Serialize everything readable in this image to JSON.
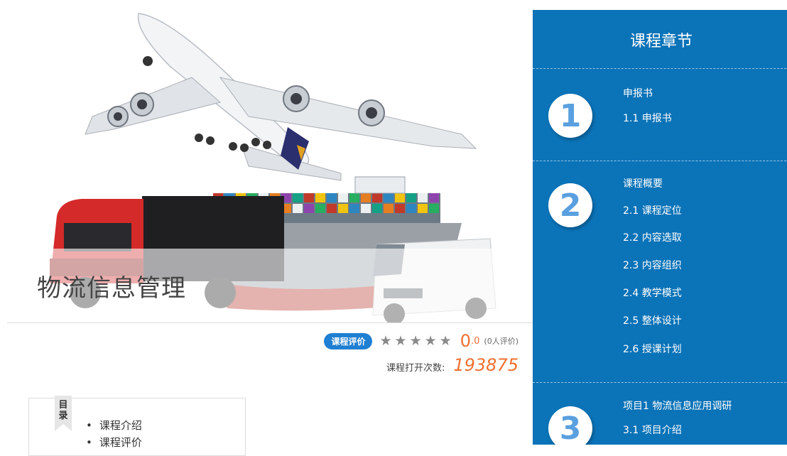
{
  "hero": {
    "title": "物流信息管理",
    "image_icon": "logistics-illustration"
  },
  "rating": {
    "badge": "课程评价",
    "stars_total": 5,
    "stars_filled": 0,
    "score_int": "0",
    "score_dec": ".0",
    "review_count": "(0人评价)"
  },
  "opens": {
    "label": "课程打开次数:",
    "value": "193875"
  },
  "outline": {
    "tab_label": "目录",
    "items": [
      "课程介绍",
      "课程评价"
    ]
  },
  "chapters": {
    "title": "课程章节",
    "sections": [
      {
        "number": "1",
        "heading": "申报书",
        "items": [
          "1.1  申报书"
        ]
      },
      {
        "number": "2",
        "heading": "课程概要",
        "items": [
          "2.1  课程定位",
          "2.2  内容选取",
          "2.3  内容组织",
          "2.4  教学模式",
          "2.5  整体设计",
          "2.6  授课计划"
        ]
      },
      {
        "number": "3",
        "heading": "项目1 物流信息应用调研",
        "items": [
          "3.1  项目介绍"
        ]
      }
    ]
  },
  "colors": {
    "sidebar_bg": "#0b73b8",
    "accent_orange": "#f07030",
    "badge_blue": "#1f7fd2"
  }
}
